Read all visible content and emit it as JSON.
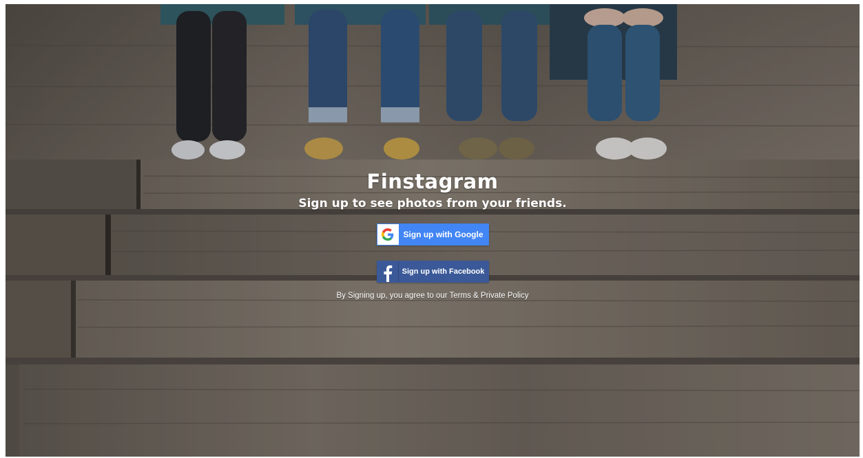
{
  "app": {
    "title": "Finstagram",
    "subtitle": "Sign up to see photos from your friends."
  },
  "buttons": {
    "google": {
      "label": "Sign up with Google",
      "icon": "google-g-icon",
      "color": "#4285f4"
    },
    "facebook": {
      "label": "Sign up with Facebook",
      "icon": "facebook-f-icon",
      "color": "#3b5998"
    }
  },
  "legal": {
    "text": "By Signing up, you agree to our Terms & Private Policy"
  }
}
